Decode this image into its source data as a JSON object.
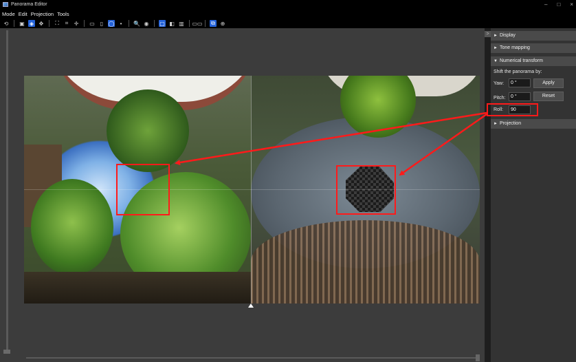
{
  "window": {
    "title": "Panorama Editor",
    "controls": [
      "–",
      "□",
      "×"
    ]
  },
  "menu": [
    "Mode",
    "Edit",
    "Projection",
    "Tools"
  ],
  "toolbar": {
    "buttons": [
      {
        "icon": "undo-icon",
        "glyph": "⟲"
      },
      {
        "icon": "image-icon",
        "glyph": "▣"
      },
      {
        "icon": "rotate-icon",
        "glyph": "◈",
        "active": true
      },
      {
        "icon": "move-icon",
        "glyph": "✥"
      },
      {
        "icon": "fit-icon",
        "glyph": "⛶"
      },
      {
        "icon": "crop-icon",
        "glyph": "⌗"
      },
      {
        "icon": "crosshair-icon",
        "glyph": "✛"
      },
      {
        "icon": "rectangle-icon",
        "glyph": "▭"
      },
      {
        "icon": "cylinder-icon",
        "glyph": "▯"
      },
      {
        "icon": "sphere-icon",
        "glyph": "◯",
        "active": true
      },
      {
        "icon": "dot-icon",
        "glyph": "•"
      },
      {
        "icon": "zoom-icon",
        "glyph": "🔍"
      },
      {
        "icon": "eye-icon",
        "glyph": "◉"
      },
      {
        "icon": "single-view-icon",
        "glyph": "▢",
        "active": true
      },
      {
        "icon": "split-view-icon",
        "glyph": "◧"
      },
      {
        "icon": "book-icon",
        "glyph": "▥"
      },
      {
        "icon": "compare-icon",
        "glyph": "▭▭"
      },
      {
        "icon": "layers-icon",
        "glyph": "⧉",
        "active": true
      },
      {
        "icon": "settings-icon",
        "glyph": "⊕"
      }
    ]
  },
  "panel": {
    "collapse_glyph": ">",
    "display": "Display",
    "tone_mapping": "Tone mapping",
    "numerical_transform": "Numerical transform",
    "shift_label": "Shift the panorama by:",
    "yaw_label": "Yaw:",
    "yaw_value": "0 °",
    "pitch_label": "Pitch:",
    "pitch_value": "0 °",
    "roll_label": "Roll:",
    "roll_value": "90",
    "apply": "Apply",
    "reset": "Reset",
    "projection": "Projection"
  },
  "colors": {
    "accent": "#2563d9",
    "highlight": "#ff1a1a"
  }
}
